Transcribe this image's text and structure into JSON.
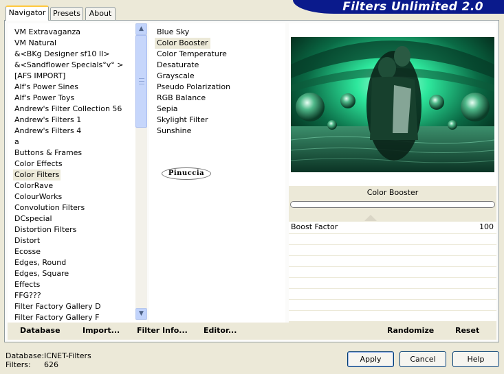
{
  "header": {
    "title": "Filters Unlimited 2.0"
  },
  "tabs": [
    {
      "label": "Navigator",
      "active": true
    },
    {
      "label": "Presets",
      "active": false
    },
    {
      "label": "About",
      "active": false
    }
  ],
  "categories": [
    " VM Extravaganza",
    " VM Natural",
    "&<BKg Designer sf10 II>",
    "&<Sandflower Specials°v° >",
    "[AFS IMPORT]",
    "Alf's Power Sines",
    "Alf's Power Toys",
    "Andrew's Filter Collection 56",
    "Andrew's Filters 1",
    "Andrew's Filters 4",
    "a",
    "Buttons & Frames",
    "Color Effects",
    "Color Filters",
    "ColorRave",
    "ColourWorks",
    "Convolution Filters",
    "DCspecial",
    "Distortion Filters",
    "Distort",
    "Ecosse",
    "Edges, Round",
    "Edges, Square",
    "Effects",
    "FFG???",
    "Filter Factory Gallery D",
    "Filter Factory Gallery F"
  ],
  "selected_category": "Color Filters",
  "filters": [
    "Blue Sky",
    "Color Booster",
    "Color Temperature",
    "Desaturate",
    "Grayscale",
    "Pseudo Polarization",
    "RGB Balance",
    "Sepia",
    "Skylight Filter",
    "Sunshine"
  ],
  "selected_filter": "Color Booster",
  "author_logo": "Pinuccia",
  "preview": {
    "filter_title": "Color Booster",
    "parameter": {
      "label": "Boost Factor",
      "value": "100"
    }
  },
  "toolbar": {
    "database": "Database",
    "import": "Import...",
    "filter_info": "Filter Info...",
    "editor": "Editor...",
    "randomize": "Randomize",
    "reset": "Reset"
  },
  "footer": {
    "database_label": "Database:",
    "database_value": "ICNET-Filters",
    "filters_label": "Filters:",
    "filters_value": "626"
  },
  "buttons": {
    "apply": "Apply",
    "cancel": "Cancel",
    "help": "Help"
  },
  "colors": {
    "banner": "#0a1a8c",
    "window_bg": "#ece9d8",
    "selection": "#ece9d8",
    "preview_accent": "#1ee89a"
  },
  "icons": {
    "scroll_up": "chevron-up-icon",
    "scroll_down": "chevron-down-icon"
  }
}
